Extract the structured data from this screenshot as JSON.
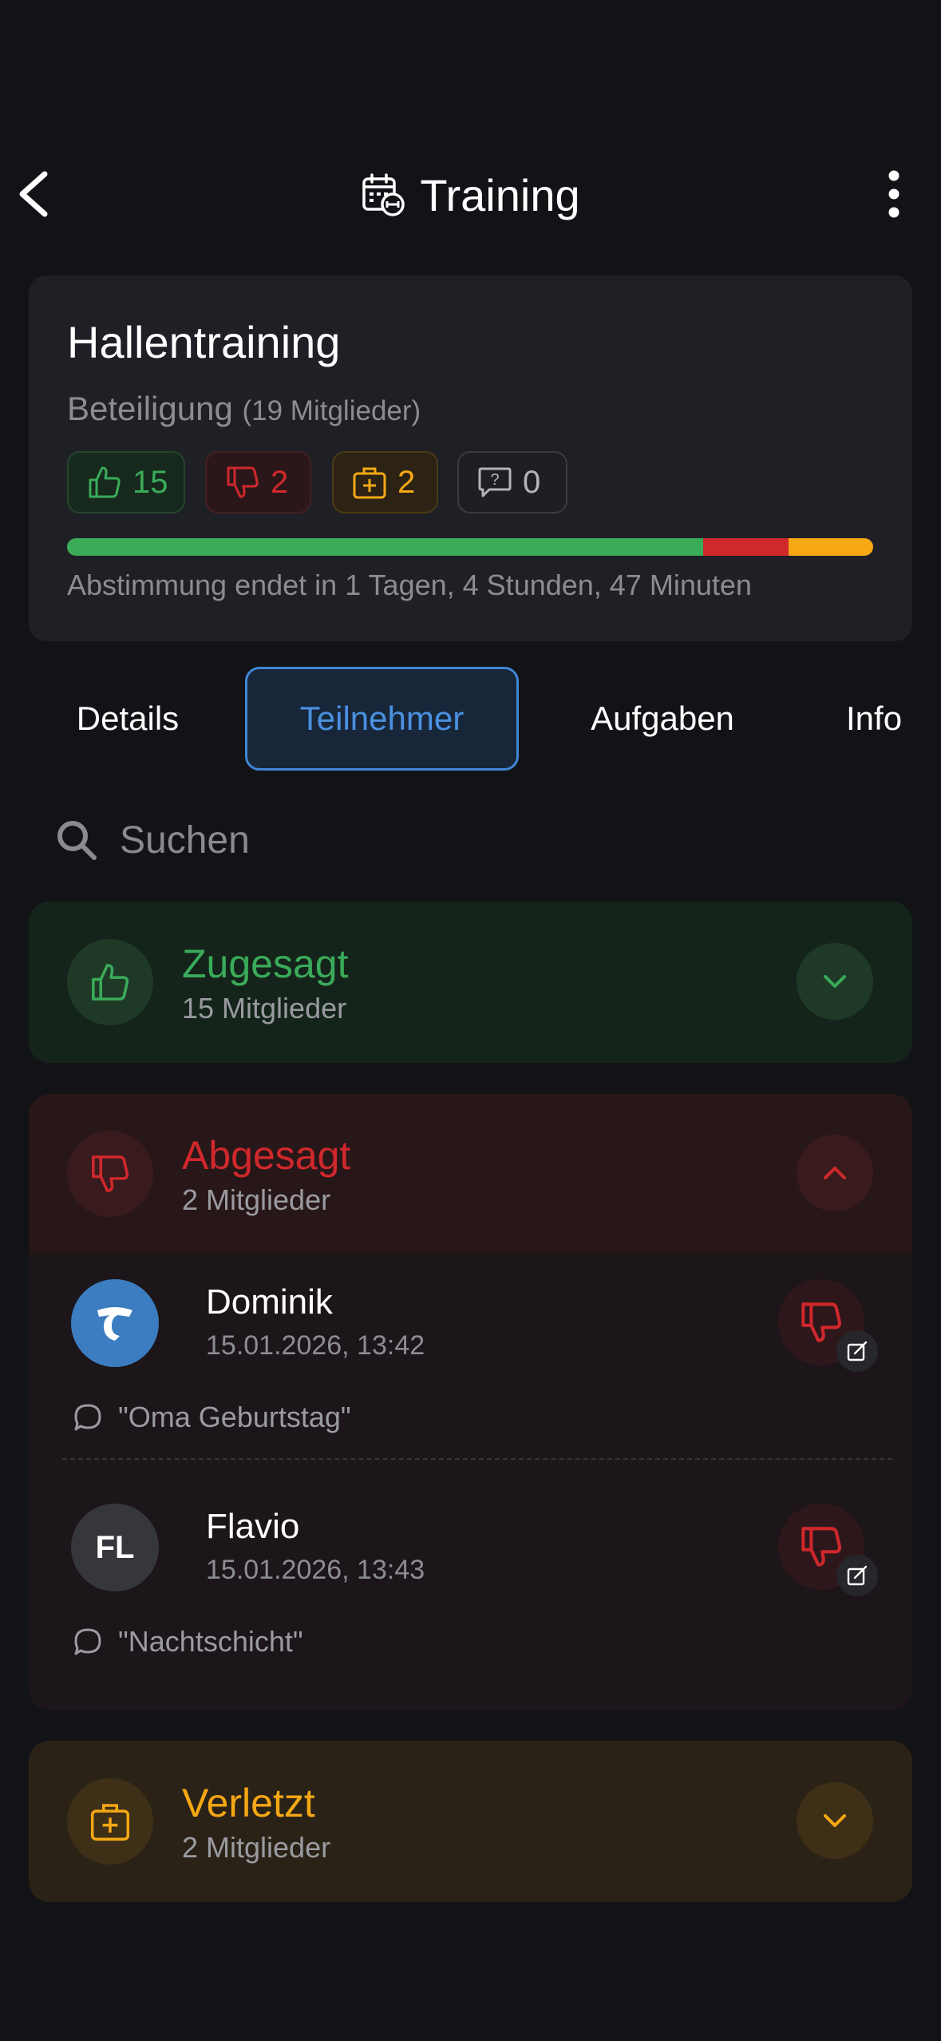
{
  "header": {
    "title": "Training",
    "back_icon": "chevron-left-icon",
    "title_icon": "calendar-training-icon",
    "menu_icon": "more-vertical-icon"
  },
  "event": {
    "title": "Hallentraining",
    "participation_label": "Beteiligung",
    "participation_count": "(19 Mitglieder)",
    "chips": {
      "yes": "15",
      "no": "2",
      "injured": "2",
      "unanswered": "0"
    },
    "progress": {
      "yes": 15,
      "no": 2,
      "injured": 2,
      "unanswered": 0
    },
    "deadline": "Abstimmung endet in 1 Tagen, 4 Stunden, 47 Minuten"
  },
  "tabs": {
    "details": "Details",
    "participants": "Teilnehmer",
    "tasks": "Aufgaben",
    "info": "Info"
  },
  "search": {
    "placeholder": "Suchen"
  },
  "groups": {
    "accepted": {
      "title": "Zugesagt",
      "count": "15 Mitglieder"
    },
    "declined": {
      "title": "Abgesagt",
      "count": "2 Mitglieder"
    },
    "injured": {
      "title": "Verletzt",
      "count": "2 Mitglieder"
    }
  },
  "declined_members": [
    {
      "name": "Dominik",
      "time": "15.01.2026, 13:42",
      "note": "\"Oma Geburtstag\""
    },
    {
      "name": "Flavio",
      "initials": "FL",
      "time": "15.01.2026, 13:43",
      "note": "\"Nachtschicht\""
    }
  ],
  "colors": {
    "green": "#3aab59",
    "red": "#d0282c",
    "orange": "#f5a814",
    "blue": "#3f86d6"
  }
}
